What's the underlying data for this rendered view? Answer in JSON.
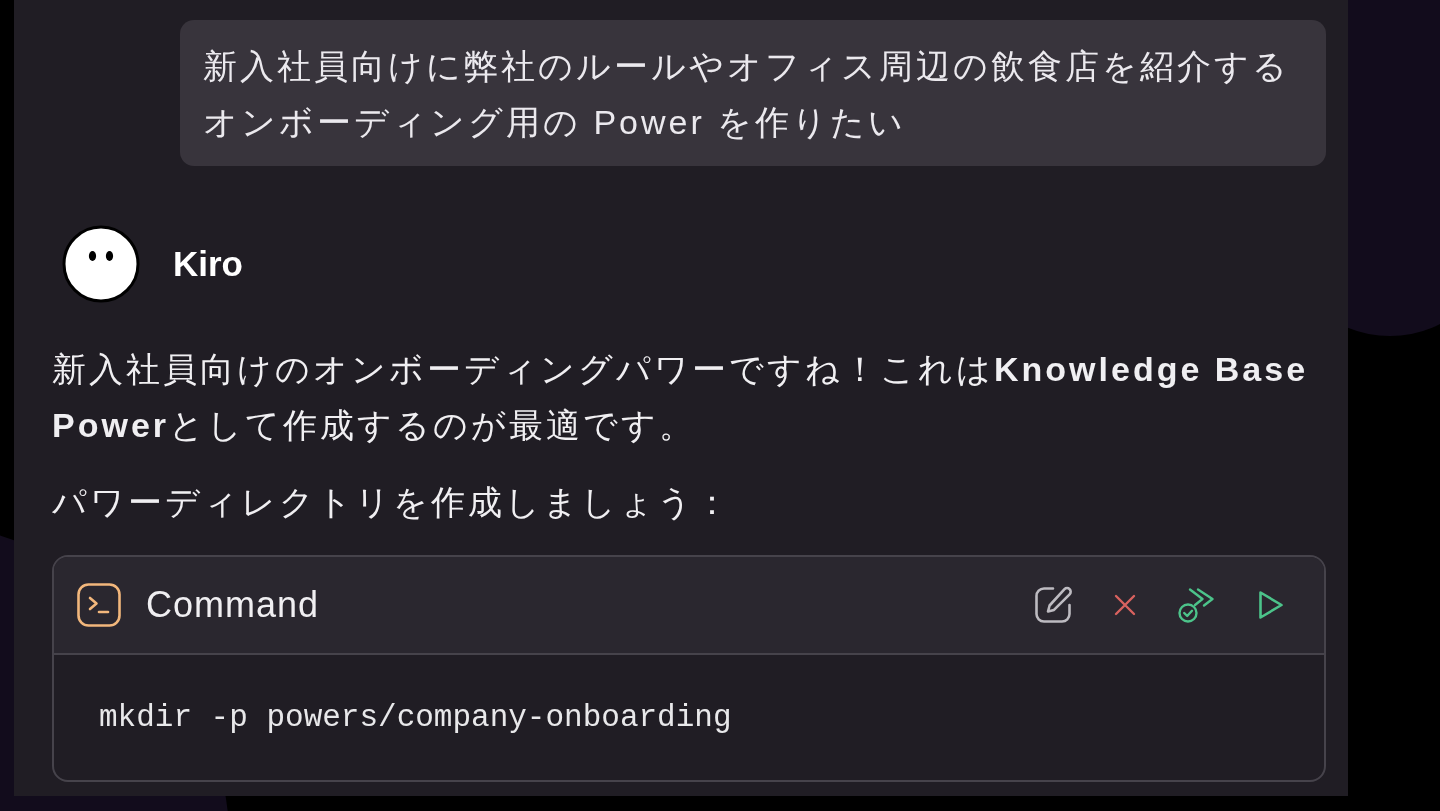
{
  "user_message": {
    "text": "新入社員向けに弊社のルールやオフィス周辺の飲食店を紹介するオンボーディング用の Power を作りたい"
  },
  "assistant": {
    "name": "Kiro",
    "paragraphs": [
      "新入社員向けのオンボーディングパワーですね！これは**Knowledge Base Power**として作成するのが最適です。",
      "パワーディレクトリを作成しましょう："
    ]
  },
  "command_block": {
    "title": "Command",
    "code": "mkdir -p powers/company-onboarding"
  }
}
